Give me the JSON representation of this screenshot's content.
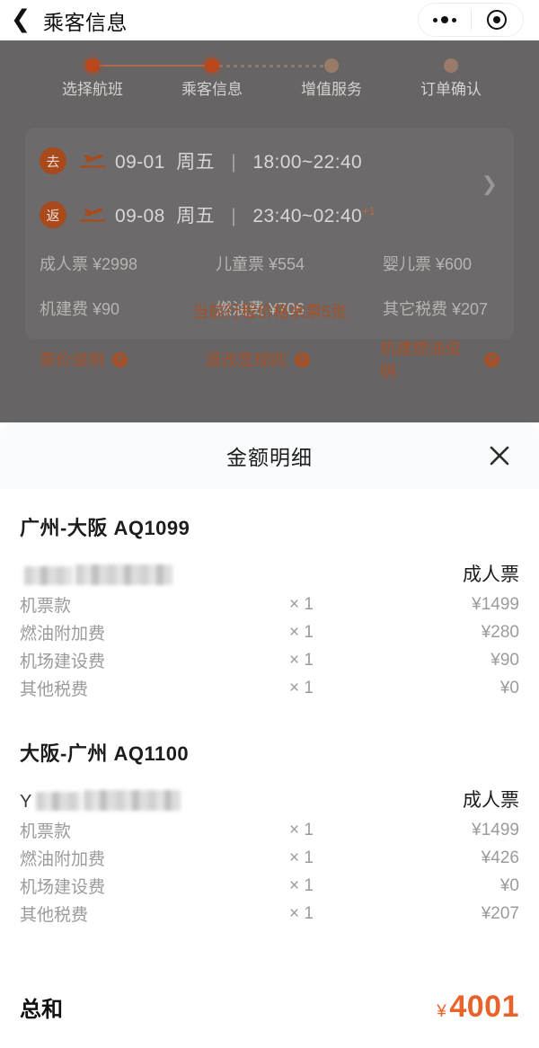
{
  "navbar": {
    "back_icon": "chevron-left-icon",
    "title": "乘客信息",
    "more_icon": "more-dots-icon",
    "target_icon": "target-circle-icon"
  },
  "stepper": {
    "steps": [
      {
        "label": "选择航班",
        "state": "done"
      },
      {
        "label": "乘客信息",
        "state": "current"
      },
      {
        "label": "增值服务",
        "state": "pending"
      },
      {
        "label": "订单确认",
        "state": "pending"
      }
    ]
  },
  "flight_card": {
    "chevron_icon": "chevron-right-icon",
    "legs": [
      {
        "badge": "去",
        "plane_icon": "plane-takeoff-icon",
        "date": "09-01",
        "weekday": "周五",
        "separator": "|",
        "time": "18:00~22:40",
        "next_day": ""
      },
      {
        "badge": "返",
        "plane_icon": "plane-takeoff-icon",
        "date": "09-08",
        "weekday": "周五",
        "separator": "|",
        "time": "23:40~02:40",
        "next_day": "+1"
      }
    ],
    "fares": [
      [
        "成人票 ¥2998",
        "儿童票 ¥554",
        "婴儿票 ¥600"
      ],
      [
        "机建费 ¥90",
        "燃油费 ¥706",
        "其它税费 ¥207"
      ]
    ],
    "links": [
      {
        "label": "票价说明",
        "icon": "question-mark-icon"
      },
      {
        "label": "退改签规则",
        "icon": "question-mark-icon"
      },
      {
        "label": "机建燃油说明",
        "icon": "question-mark-icon"
      }
    ],
    "remaining": "当前行程价格余票5张"
  },
  "sheet": {
    "title": "金额明细",
    "close_icon": "close-x-icon",
    "segments": [
      {
        "route": "广州-大阪  AQ1099",
        "passenger_name_prefix": "",
        "passenger_name_masked": true,
        "passenger_type": "成人票",
        "fees": [
          {
            "name": "机票款",
            "qty": "× 1",
            "amount": "¥1499"
          },
          {
            "name": "燃油附加费",
            "qty": "× 1",
            "amount": "¥280"
          },
          {
            "name": "机场建设费",
            "qty": "× 1",
            "amount": "¥90"
          },
          {
            "name": "其他税费",
            "qty": "× 1",
            "amount": "¥0"
          }
        ]
      },
      {
        "route": "大阪-广州  AQ1100",
        "passenger_name_prefix": "Y",
        "passenger_name_masked": true,
        "passenger_type": "成人票",
        "fees": [
          {
            "name": "机票款",
            "qty": "× 1",
            "amount": "¥1499"
          },
          {
            "name": "燃油附加费",
            "qty": "× 1",
            "amount": "¥426"
          },
          {
            "name": "机场建设费",
            "qty": "× 1",
            "amount": "¥0"
          },
          {
            "name": "其他税费",
            "qty": "× 1",
            "amount": "¥207"
          }
        ]
      }
    ],
    "total": {
      "label": "总和",
      "currency": "¥",
      "value": "4001"
    }
  },
  "colors": {
    "accent_orange": "#e8622a",
    "link_orange": "#a4512a",
    "badge_orange": "#a84a1c",
    "overlay_gray": "#666464",
    "text_dark": "#1d1d1d",
    "text_muted": "#9b9b9b"
  }
}
